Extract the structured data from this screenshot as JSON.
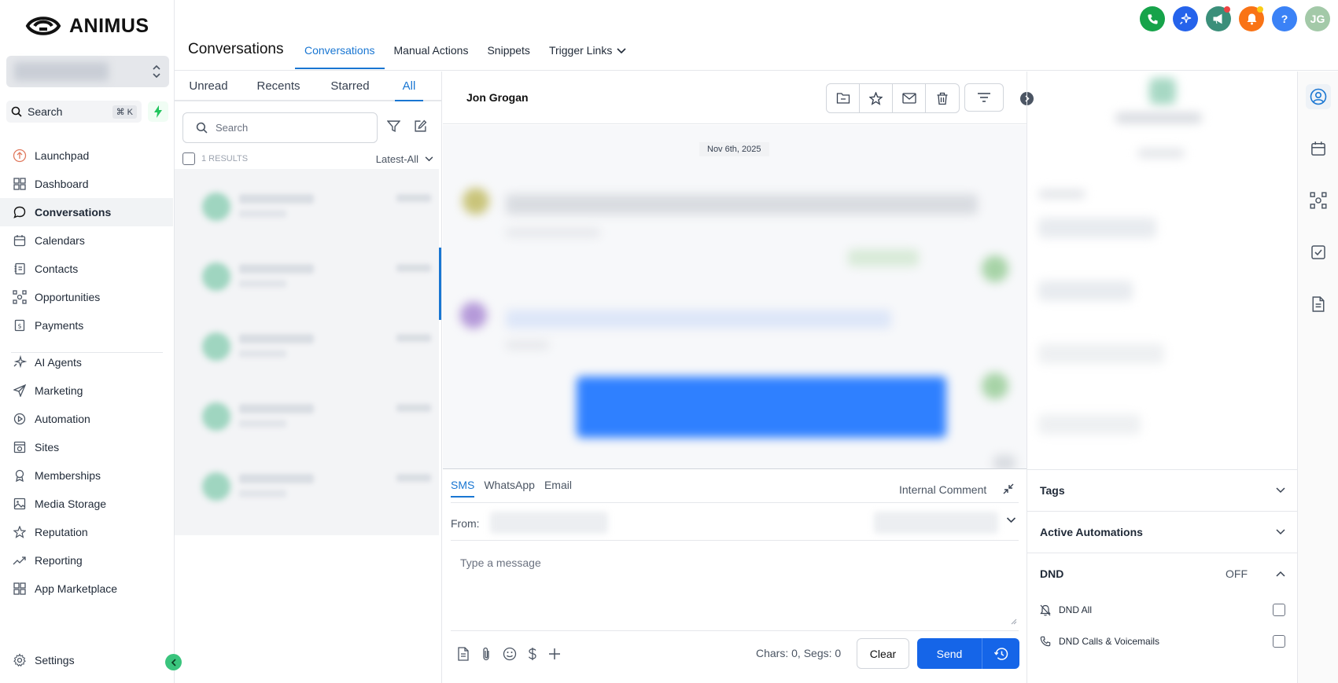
{
  "brand": {
    "name": "ANIMUS"
  },
  "sidebar": {
    "search_label": "Search",
    "search_shortcut": "⌘ K",
    "items": [
      {
        "label": "Launchpad",
        "icon": "launchpad-icon"
      },
      {
        "label": "Dashboard",
        "icon": "dashboard-icon"
      },
      {
        "label": "Conversations",
        "icon": "chat-icon",
        "active": true
      },
      {
        "label": "Calendars",
        "icon": "calendar-icon"
      },
      {
        "label": "Contacts",
        "icon": "contacts-icon"
      },
      {
        "label": "Opportunities",
        "icon": "opportunities-icon"
      },
      {
        "label": "Payments",
        "icon": "payments-icon"
      }
    ],
    "items2": [
      {
        "label": "AI Agents",
        "icon": "sparkle-icon"
      },
      {
        "label": "Marketing",
        "icon": "send-icon"
      },
      {
        "label": "Automation",
        "icon": "automation-icon"
      },
      {
        "label": "Sites",
        "icon": "sites-icon"
      },
      {
        "label": "Memberships",
        "icon": "award-icon"
      },
      {
        "label": "Media Storage",
        "icon": "image-icon"
      },
      {
        "label": "Reputation",
        "icon": "star-icon"
      },
      {
        "label": "Reporting",
        "icon": "trend-icon"
      },
      {
        "label": "App Marketplace",
        "icon": "grid-icon"
      }
    ],
    "settings_label": "Settings"
  },
  "header": {
    "title": "Conversations",
    "tabs": [
      "Conversations",
      "Manual Actions",
      "Snippets",
      "Trigger Links"
    ],
    "user_initials": "JG",
    "help": "?"
  },
  "list": {
    "filters": [
      "Unread",
      "Recents",
      "Starred",
      "All"
    ],
    "active_filter": "All",
    "search_placeholder": "Search",
    "results": "1 RESULTS",
    "sort": "Latest-All"
  },
  "chat": {
    "contact_name": "Jon Grogan",
    "date": "Nov 6th, 2025",
    "channels": [
      "SMS",
      "WhatsApp",
      "Email"
    ],
    "active_channel": "SMS",
    "internal_comment": "Internal Comment",
    "from_label": "From:",
    "message_placeholder": "Type a message",
    "counter": "Chars: 0, Segs: 0",
    "clear_label": "Clear",
    "send_label": "Send"
  },
  "details": {
    "tags_label": "Tags",
    "automations_label": "Active Automations",
    "dnd_label": "DND",
    "dnd_state": "OFF",
    "dnd_all": "DND All",
    "dnd_calls": "DND Calls & Voicemails"
  },
  "colors": {
    "accent": "#1976d2",
    "send": "#1565e8",
    "phone": "#16a34a",
    "ai": "#2563eb",
    "announce": "#3b8f7a",
    "bell": "#f97316",
    "help": "#3b82f6",
    "avatar": "#a3c9a8"
  }
}
